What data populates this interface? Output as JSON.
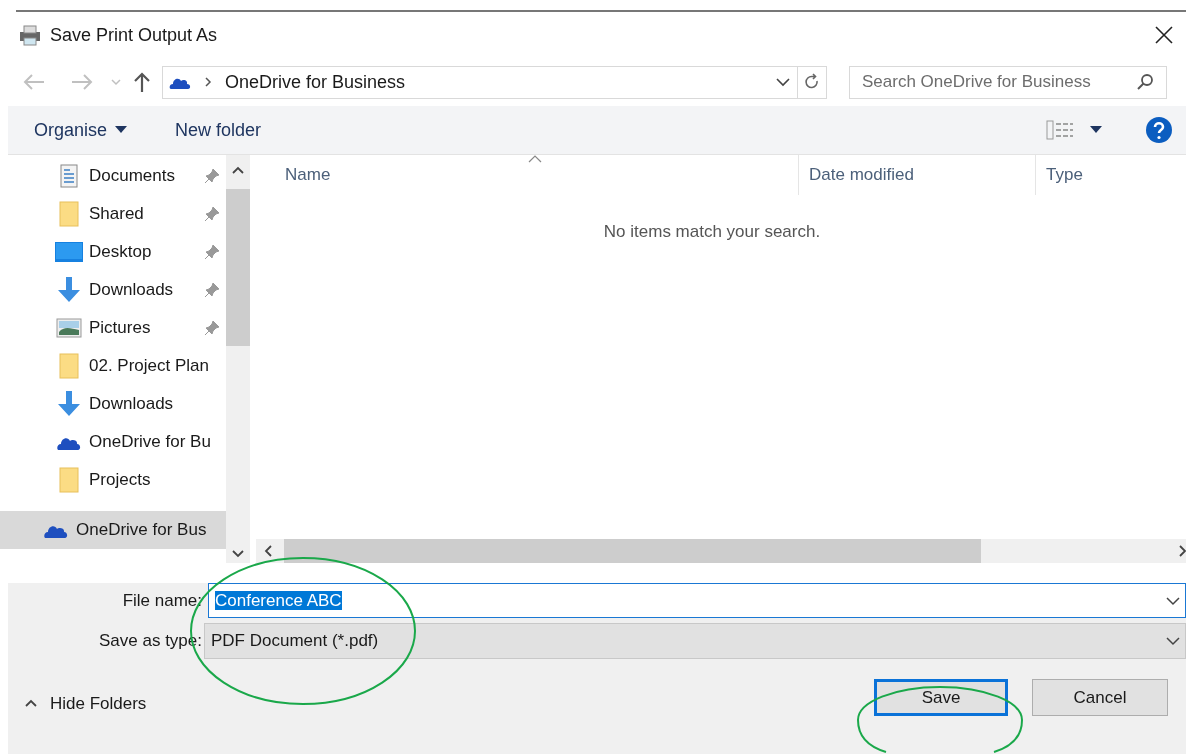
{
  "window": {
    "title": "Save Print Output As"
  },
  "address_bar": {
    "path": "OneDrive for Business"
  },
  "search": {
    "placeholder": "Search OneDrive for Business"
  },
  "toolbar": {
    "organise": "Organise",
    "new_folder": "New folder"
  },
  "sidebar": {
    "items": [
      {
        "label": "Documents",
        "kind": "documents",
        "pinned": true,
        "selected": false
      },
      {
        "label": "Shared",
        "kind": "folder",
        "pinned": true,
        "selected": false
      },
      {
        "label": "Desktop",
        "kind": "desktop",
        "pinned": true,
        "selected": false
      },
      {
        "label": "Downloads",
        "kind": "downloads",
        "pinned": true,
        "selected": false
      },
      {
        "label": "Pictures",
        "kind": "pictures",
        "pinned": true,
        "selected": false
      },
      {
        "label": "02. Project Plan",
        "kind": "folder",
        "pinned": false,
        "selected": false
      },
      {
        "label": "Downloads",
        "kind": "downloads",
        "pinned": false,
        "selected": false
      },
      {
        "label": "OneDrive for Bu",
        "kind": "cloud",
        "pinned": false,
        "selected": false
      },
      {
        "label": "Projects",
        "kind": "folder",
        "pinned": false,
        "selected": false
      },
      {
        "label": "OneDrive for Bus",
        "kind": "cloud",
        "pinned": false,
        "selected": true
      }
    ]
  },
  "file_list": {
    "columns": [
      "Name",
      "Date modified",
      "Type"
    ],
    "empty_message": "No items match your search."
  },
  "file_name": {
    "label": "File name:",
    "value": "Conference ABC",
    "text_selected": true
  },
  "save_as_type": {
    "label": "Save as type:",
    "value": "PDF Document (*.pdf)"
  },
  "hide_folders": "Hide Folders",
  "buttons": [
    {
      "label": "Save",
      "default": true
    },
    {
      "label": "Cancel",
      "default": false
    }
  ]
}
